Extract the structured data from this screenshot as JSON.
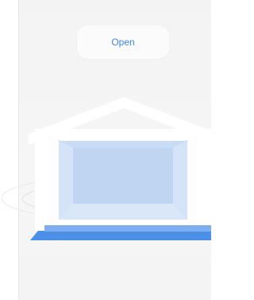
{
  "open_button": {
    "label": "Open"
  },
  "colors": {
    "accent": "#3a86e8",
    "door_fill": "#c9dcf5",
    "platform": "#4b8fe6",
    "structure": "#ffffff"
  },
  "icons": {
    "garage": "garage-illustration"
  }
}
